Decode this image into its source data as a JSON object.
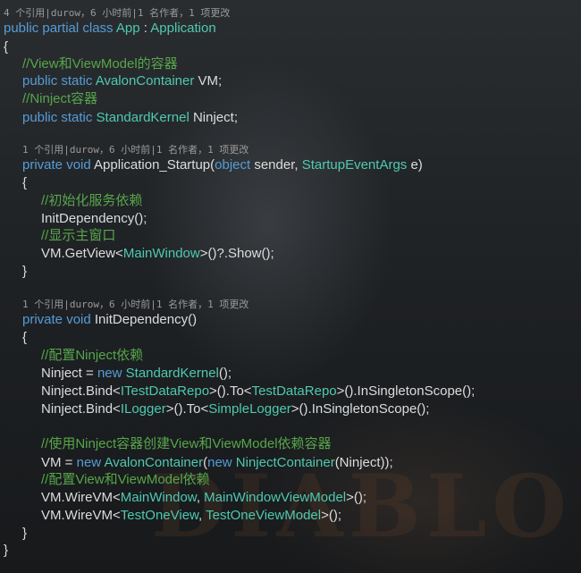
{
  "code_lens": [
    "4 个引用|durow，6 小时前|1 名作者，1 项更改",
    "1 个引用|durow，6 小时前|1 名作者，1 项更改",
    "1 个引用|durow，6 小时前|1 名作者，1 项更改"
  ],
  "lines": [
    [
      [
        "kw",
        "public partial class "
      ],
      [
        "ty",
        "App"
      ],
      [
        "tx",
        " : "
      ],
      [
        "ty",
        "Application"
      ]
    ],
    [
      [
        "tx",
        "{"
      ]
    ],
    [
      [
        "cm",
        "//View和ViewModel的容器"
      ]
    ],
    [
      [
        "kw",
        "public static "
      ],
      [
        "ty",
        "AvalonContainer"
      ],
      [
        "tx",
        " VM;"
      ]
    ],
    [
      [
        "cm",
        "//Ninject容器"
      ]
    ],
    [
      [
        "kw",
        "public static "
      ],
      [
        "ty",
        "StandardKernel"
      ],
      [
        "tx",
        " Ninject;"
      ]
    ],
    [
      [
        "kw",
        "private void "
      ],
      [
        "tx",
        "Application_Startup("
      ],
      [
        "kw",
        "object"
      ],
      [
        "tx",
        " sender, "
      ],
      [
        "ty",
        "StartupEventArgs"
      ],
      [
        "tx",
        " e)"
      ]
    ],
    [
      [
        "tx",
        "{"
      ]
    ],
    [
      [
        "cm",
        "//初始化服务依赖"
      ]
    ],
    [
      [
        "tx",
        "InitDependency();"
      ]
    ],
    [
      [
        "cm",
        "//显示主窗口"
      ]
    ],
    [
      [
        "tx",
        "VM.GetView<"
      ],
      [
        "ty",
        "MainWindow"
      ],
      [
        "tx",
        ">()?.Show();"
      ]
    ],
    [
      [
        "tx",
        "}"
      ]
    ],
    [
      [
        "kw",
        "private void "
      ],
      [
        "tx",
        "InitDependency()"
      ]
    ],
    [
      [
        "tx",
        "{"
      ]
    ],
    [
      [
        "cm",
        "//配置Ninject依赖"
      ]
    ],
    [
      [
        "tx",
        "Ninject = "
      ],
      [
        "kw",
        "new "
      ],
      [
        "ty",
        "StandardKernel"
      ],
      [
        "tx",
        "();"
      ]
    ],
    [
      [
        "tx",
        "Ninject.Bind<"
      ],
      [
        "ty",
        "ITestDataRepo"
      ],
      [
        "tx",
        ">().To<"
      ],
      [
        "ty",
        "TestDataRepo"
      ],
      [
        "tx",
        ">().InSingletonScope();"
      ]
    ],
    [
      [
        "tx",
        "Ninject.Bind<"
      ],
      [
        "ty",
        "ILogger"
      ],
      [
        "tx",
        ">().To<"
      ],
      [
        "ty",
        "SimpleLogger"
      ],
      [
        "tx",
        ">().InSingletonScope();"
      ]
    ],
    [
      [
        "cm",
        "//使用Ninject容器创建View和ViewModel依赖容器"
      ]
    ],
    [
      [
        "tx",
        "VM = "
      ],
      [
        "kw",
        "new "
      ],
      [
        "ty",
        "AvalonContainer"
      ],
      [
        "tx",
        "("
      ],
      [
        "kw",
        "new "
      ],
      [
        "ty",
        "NinjectContainer"
      ],
      [
        "tx",
        "(Ninject));"
      ]
    ],
    [
      [
        "cm",
        "//配置View和ViewModel依赖"
      ]
    ],
    [
      [
        "tx",
        "VM.WireVM<"
      ],
      [
        "ty",
        "MainWindow"
      ],
      [
        "tx",
        ", "
      ],
      [
        "ty",
        "MainWindowViewModel"
      ],
      [
        "tx",
        ">();"
      ]
    ],
    [
      [
        "tx",
        "VM.WireVM<"
      ],
      [
        "ty",
        "TestOneView"
      ],
      [
        "tx",
        ", "
      ],
      [
        "ty",
        "TestOneViewModel"
      ],
      [
        "tx",
        ">();"
      ]
    ],
    [
      [
        "tx",
        "}"
      ]
    ],
    [
      [
        "tx",
        "}"
      ]
    ]
  ],
  "background_watermark_text": "DIABLO",
  "colors": {
    "keyword": "#569cd6",
    "type": "#4ec9b0",
    "comment": "#57a64a",
    "text": "#dcdcdc",
    "codelens": "#9a9a9a"
  }
}
